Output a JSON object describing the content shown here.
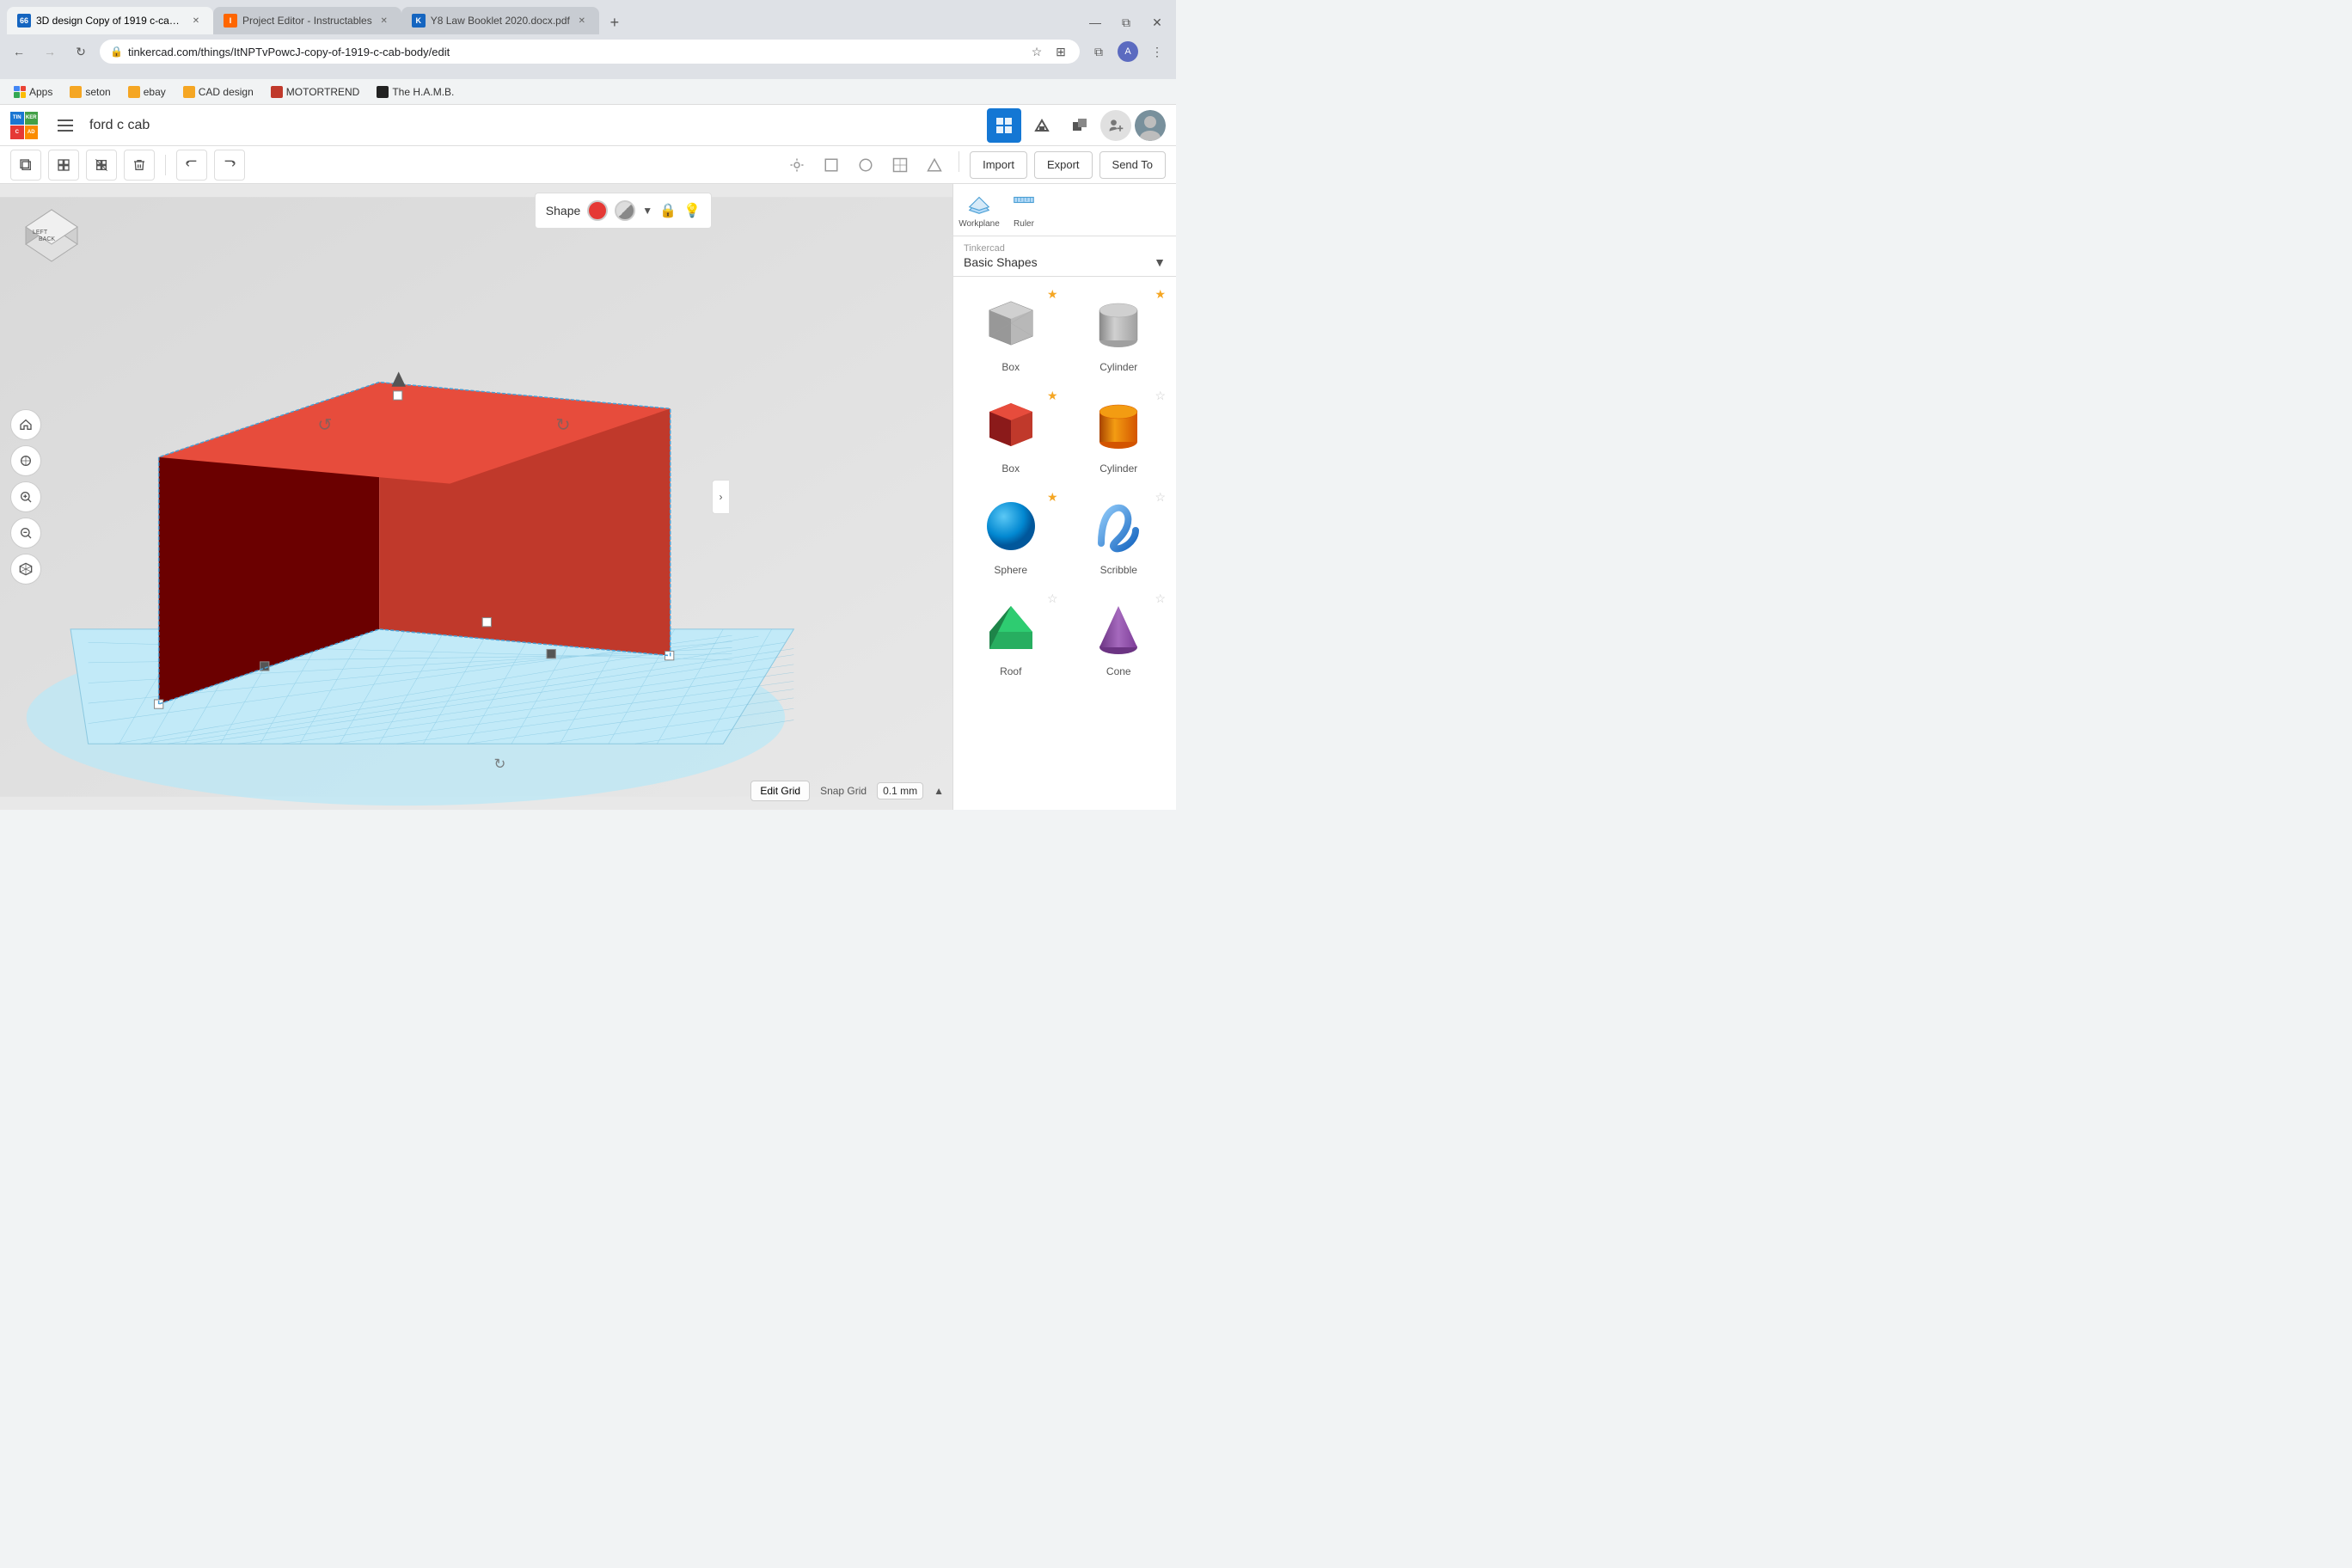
{
  "browser": {
    "tabs": [
      {
        "id": "tab1",
        "title": "3D design Copy of 1919 c-cab b...",
        "favicon_color": "#1565c0",
        "favicon_text": "66",
        "active": true
      },
      {
        "id": "tab2",
        "title": "Project Editor - Instructables",
        "favicon_color": "#ff6600",
        "favicon_text": "I",
        "active": false
      },
      {
        "id": "tab3",
        "title": "Y8 Law Booklet 2020.docx.pdf",
        "favicon_color": "#1565c0",
        "favicon_text": "K",
        "active": false
      }
    ],
    "url": "tinkercad.com/things/ItNPTvPowcJ-copy-of-1919-c-cab-body/edit",
    "new_tab_label": "+",
    "back_disabled": false,
    "forward_disabled": false
  },
  "bookmarks": {
    "apps_label": "Apps",
    "items": [
      {
        "label": "seton",
        "color": "#f5a623"
      },
      {
        "label": "ebay",
        "color": "#f5a623"
      },
      {
        "label": "CAD design",
        "color": "#f5a623"
      },
      {
        "label": "MOTORTREND",
        "color": "#c0392b"
      },
      {
        "label": "The H.A.M.B.",
        "color": "#222"
      }
    ]
  },
  "topbar": {
    "project_name": "ford c cab",
    "view_buttons": [
      {
        "id": "grid",
        "active": true,
        "icon": "⊞"
      },
      {
        "id": "build",
        "active": false,
        "icon": "🔨"
      },
      {
        "id": "blocks",
        "active": false,
        "icon": "▣"
      },
      {
        "id": "add-user",
        "active": false,
        "icon": "+👤"
      }
    ]
  },
  "actionbar": {
    "copy_label": "⧉",
    "group_label": "⊕",
    "ungroup_label": "⊖",
    "delete_label": "🗑",
    "undo_label": "↩",
    "redo_label": "↪",
    "right_actions": [
      {
        "label": "💡",
        "id": "light"
      },
      {
        "label": "◻",
        "id": "shape"
      },
      {
        "label": "⊙",
        "id": "circle"
      },
      {
        "label": "▣",
        "id": "grid"
      },
      {
        "label": "△",
        "id": "triangle"
      }
    ],
    "import_label": "Import",
    "export_label": "Export",
    "send_to_label": "Send To"
  },
  "viewport": {
    "snap_grid_label": "Snap Grid",
    "snap_grid_value": "0.1 mm",
    "edit_grid_label": "Edit Grid"
  },
  "shape_panel": {
    "title": "Shape",
    "color_red": "#e53935",
    "panel_arrow": "▼"
  },
  "right_panel": {
    "section_label": "Tinkercad",
    "section_name": "Basic Shapes",
    "shapes": [
      {
        "name": "Box",
        "starred": true,
        "type": "gray-box"
      },
      {
        "name": "Cylinder",
        "starred": true,
        "type": "gray-cylinder"
      },
      {
        "name": "Box",
        "starred": true,
        "type": "red-box"
      },
      {
        "name": "Cylinder",
        "starred": false,
        "type": "orange-cylinder"
      },
      {
        "name": "Sphere",
        "starred": true,
        "type": "blue-sphere"
      },
      {
        "name": "Scribble",
        "starred": false,
        "type": "blue-scribble"
      },
      {
        "name": "Roof",
        "starred": false,
        "type": "green-roof"
      },
      {
        "name": "Cone",
        "starred": false,
        "type": "purple-cone"
      }
    ],
    "workplane_label": "Workplane",
    "ruler_label": "Ruler"
  },
  "orientation_cube": {
    "back_label": "BACK",
    "left_label": "LEFT"
  }
}
